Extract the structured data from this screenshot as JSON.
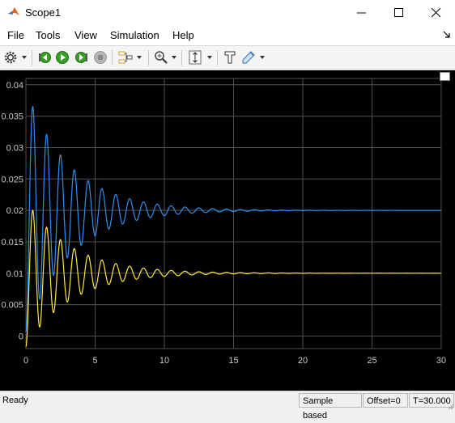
{
  "window": {
    "title": "Scope1"
  },
  "menu": [
    "File",
    "Tools",
    "View",
    "Simulation",
    "Help"
  ],
  "toolbar_icons": [
    "gear-icon",
    "rewind-step-icon",
    "run-icon",
    "step-forward-icon",
    "stop-icon",
    "signal-selector-icon",
    "zoom-icon",
    "scale-axes-icon",
    "highlight-block-icon",
    "style-icon"
  ],
  "colors": {
    "series1": "#2d8ff0",
    "series2": "#ffea3a",
    "background": "#000000",
    "grid": "#4f4f4f",
    "axis_text": "#c8c8c8"
  },
  "status": {
    "state": "Ready",
    "mode": "Sample based",
    "offset": "Offset=0",
    "time": "T=30.000"
  },
  "chart_data": {
    "type": "line",
    "xlim": [
      0,
      30
    ],
    "ylim": [
      -0.002,
      0.041
    ],
    "x_ticks": [
      0,
      5,
      10,
      15,
      20,
      25,
      30
    ],
    "y_ticks": [
      0,
      0.005,
      0.01,
      0.015,
      0.02,
      0.025,
      0.03,
      0.035,
      0.04
    ],
    "x_tick_labels": [
      "0",
      "5",
      "10",
      "15",
      "20",
      "25",
      "30"
    ],
    "y_tick_labels": [
      "0",
      "0.005",
      "0.01",
      "0.015",
      "0.02",
      "0.025",
      "0.03",
      "0.035",
      "0.04"
    ],
    "grid": true,
    "series": [
      {
        "color": "#2d8ff0",
        "steady_state": 0.02,
        "peak": 0.0365,
        "peak_time": 0.5,
        "period": 1.0,
        "decay_time_const": 3.2
      },
      {
        "color": "#ffea3a",
        "steady_state": 0.01,
        "peak": 0.02,
        "peak_time": 0.5,
        "period": 1.0,
        "decay_time_const": 3.2
      }
    ]
  }
}
